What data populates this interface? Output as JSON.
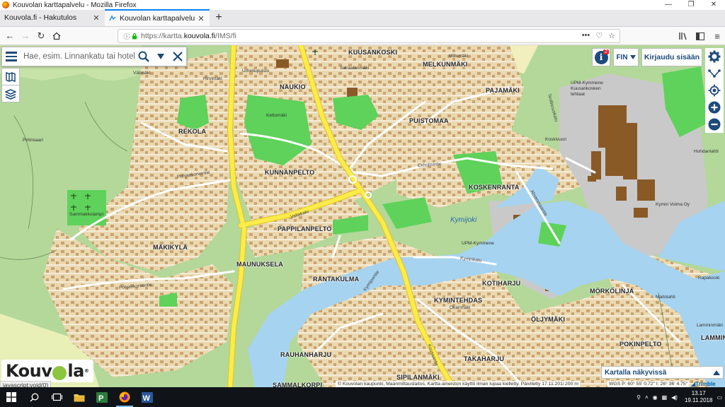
{
  "window": {
    "title": "Kouvolan karttapalvelu - Mozilla Firefox",
    "controls": [
      "—",
      "❐",
      "✕"
    ]
  },
  "tabs": [
    {
      "label": "Kouvola.fi - Hakutulos",
      "active": false
    },
    {
      "label": "Kouvolan karttapalvelu",
      "active": true
    }
  ],
  "urlbar": {
    "url_prefix": "https://kartta.",
    "url_domain": "kouvola.fi",
    "url_path": "/IMS/fi",
    "actions": [
      "•••",
      "♡",
      "☆"
    ]
  },
  "search": {
    "placeholder": "Hae, esim. Linnankatu tai hotelli"
  },
  "top_controls": {
    "info_badge": "2",
    "language": "FIN",
    "login_label": "Kirjaudu sisään"
  },
  "map": {
    "water_color": "#a6d3ef",
    "urban_color": "#e9d7b0",
    "building_color": "#c8a06a",
    "industrial_building_color": "#8a5a26",
    "highway_color": "#f6e53a",
    "park_color": "#5ed25a",
    "places": {
      "kuusankoski": "KUUSANKOSKI",
      "melkunmaki": "MELKUNMÄKI",
      "naukio": "NAUKIO",
      "pajamaki": "PAJAMÄKI",
      "puistomaa": "PUISTOMAA",
      "rekola": "REKOLA",
      "kunnanpelto": "KUNNANPELTO",
      "koskenranta": "KOSKENRANTA",
      "pappilanpelto": "PAPPILANPELTO",
      "makikyla": "MÄKIKYLÄ",
      "maunuksela": "MAUNUKSELA",
      "rantakulma": "RANTAKULMA",
      "kotiharju": "KOTIHARJU",
      "morkolinja": "MÖRKÖLINJA",
      "kyminteh": "KYMINTEHDAS",
      "oljymaki": "ÖLJYMÄKI",
      "rauhanharju": "RAUHANHARJU",
      "takaharju": "TAKAHARJU",
      "pokinpelto": "POKINPELTO",
      "lammi": "LAMMIN",
      "siprilanmaki": "SIPILANMÄKI",
      "sammalkorpi": "SAMMALKORPI"
    },
    "river": "Kymijoki",
    "small_labels": {
      "pirtinsaari": "Pirtinsaari",
      "kettumaki": "Kettumäki",
      "upm": "UPM-Kymmene",
      "upm_mill": "UPM-Kymmene Kuusankosken tehtaat",
      "kymin_voima": "Kymin Voima Oy",
      "koskivuori": "Koskivuori",
      "hirvimaki": "Hirvimäki",
      "valimaki": "Välimäki",
      "sairaalanmaki": "Sairaalanmäki",
      "millumaki": "Millumäki",
      "okanmaki": "Okanmäki",
      "rapakoski": "Rapakoski",
      "maitolahti": "Maitolahti",
      "huhdanlahti": "Huhdanlahti",
      "urheilupuisto": "Urheilupuisto",
      "lamminmaki": "Lamminmäki",
      "sammakkolampi": "Sammakkolampi"
    },
    "roads": {
      "pohjankorventie": "Pohjankorventie",
      "vattukatu": "Valtakatu",
      "ekholmintie": "Ekholmintie",
      "kyminkatu": "Kyminkatu",
      "kuusaantie": "Kuusaantie",
      "karjalantie": "Kymijoentie",
      "ahvenmaantie": "Ahvenmaantie",
      "teollisuuskatu": "Teollisuuskatu"
    }
  },
  "bottom": {
    "logo_text_1": "Kouv",
    "logo_text_2": "la",
    "logo_reg": "®",
    "js_status": "javascript:void(0)",
    "copyright": "© Kouvolan kaupunki, Maanmittauslaitos, Kartta-aineiston käyttö ilman lupaa kielletty. Päivitetty 17.11.2018",
    "scale": "200 m",
    "coords": "WGS P: 60° 55' 0.72\" I: 26° 36' 4.75\"",
    "visible_label": "Kartalla näkyvissä",
    "trimble": "Trimble"
  },
  "taskbar": {
    "time": "13.17",
    "date": "19.11.2018"
  }
}
